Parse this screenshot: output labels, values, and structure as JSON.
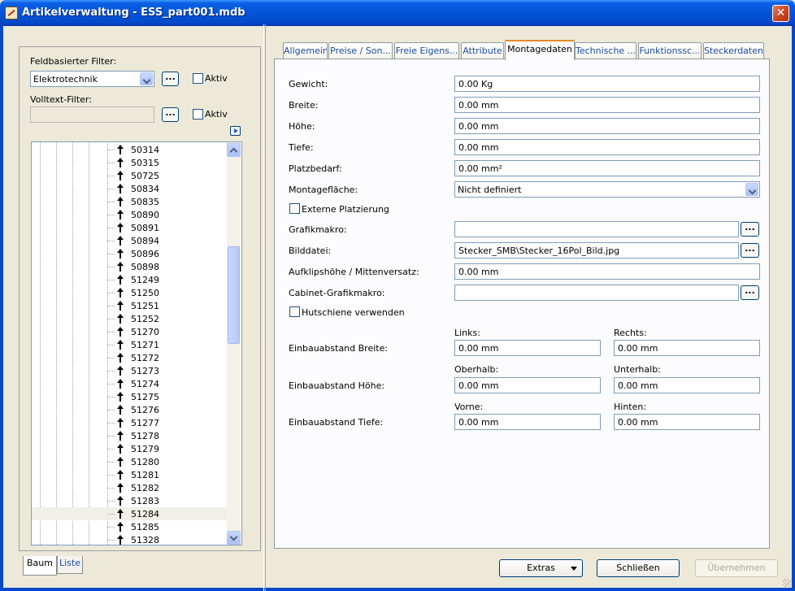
{
  "window": {
    "title": "Artikelverwaltung - ESS_part001.mdb"
  },
  "left": {
    "field_filter_label": "Feldbasierter Filter:",
    "field_filter_value": "Elektrotechnik",
    "fulltext_filter_label": "Volltext-Filter:",
    "fulltext_filter_value": "",
    "active_label_1": "Aktiv",
    "active_label_2": "Aktiv",
    "dots": "...",
    "tree_items": [
      "50314",
      "50315",
      "50725",
      "50834",
      "50835",
      "50890",
      "50891",
      "50894",
      "50896",
      "50898",
      "51249",
      "51250",
      "51251",
      "51252",
      "51270",
      "51271",
      "51272",
      "51273",
      "51274",
      "51275",
      "51276",
      "51277",
      "51278",
      "51279",
      "51280",
      "51281",
      "51282",
      "51283",
      "51284",
      "51285",
      "51328"
    ],
    "selected_item": "51284",
    "tab_tree": "Baum",
    "tab_list": "Liste"
  },
  "tabs": [
    {
      "label": "Allgemein"
    },
    {
      "label": "Preise / Son..."
    },
    {
      "label": "Freie Eigens..."
    },
    {
      "label": "Attribute"
    },
    {
      "label": "Montagedaten"
    },
    {
      "label": "Technische ..."
    },
    {
      "label": "Funktionssc..."
    },
    {
      "label": "Steckerdaten"
    }
  ],
  "active_tab": "Montagedaten",
  "form": {
    "gewicht_label": "Gewicht:",
    "gewicht": "0.00 Kg",
    "breite_label": "Breite:",
    "breite": "0.00 mm",
    "hoehe_label": "Höhe:",
    "hoehe": "0.00 mm",
    "tiefe_label": "Tiefe:",
    "tiefe": "0.00 mm",
    "platzbedarf_label": "Platzbedarf:",
    "platzbedarf": "0.00 mm²",
    "montageflaeche_label": "Montagefläche:",
    "montageflaeche": "Nicht definiert",
    "externe_platzierung_label": "Externe Platzierung",
    "grafikmakro_label": "Grafikmakro:",
    "grafikmakro": "",
    "bilddatei_label": "Bilddatei:",
    "bilddatei": "Stecker_SMB\\Stecker_16Pol_Bild.jpg",
    "aufklipshoehe_label": "Aufklipshöhe / Mittenversatz:",
    "aufklipshoehe": "0.00 mm",
    "cabinet_grafikmakro_label": "Cabinet-Grafikmakro:",
    "cabinet_grafikmakro": "",
    "hutschiene_label": "Hutschiene verwenden",
    "links_label": "Links:",
    "rechts_label": "Rechts:",
    "oberhalb_label": "Oberhalb:",
    "unterhalb_label": "Unterhalb:",
    "vorne_label": "Vorne:",
    "hinten_label": "Hinten:",
    "einbau_breite_label": "Einbauabstand Breite:",
    "einbau_hoehe_label": "Einbauabstand Höhe:",
    "einbau_tiefe_label": "Einbauabstand Tiefe:",
    "links": "0.00 mm",
    "rechts": "0.00 mm",
    "oberhalb": "0.00 mm",
    "unterhalb": "0.00 mm",
    "vorne": "0.00 mm",
    "hinten": "0.00 mm",
    "dots": "..."
  },
  "buttons": {
    "extras": "Extras",
    "schliessen": "Schließen",
    "uebernehmen": "Übernehmen"
  }
}
